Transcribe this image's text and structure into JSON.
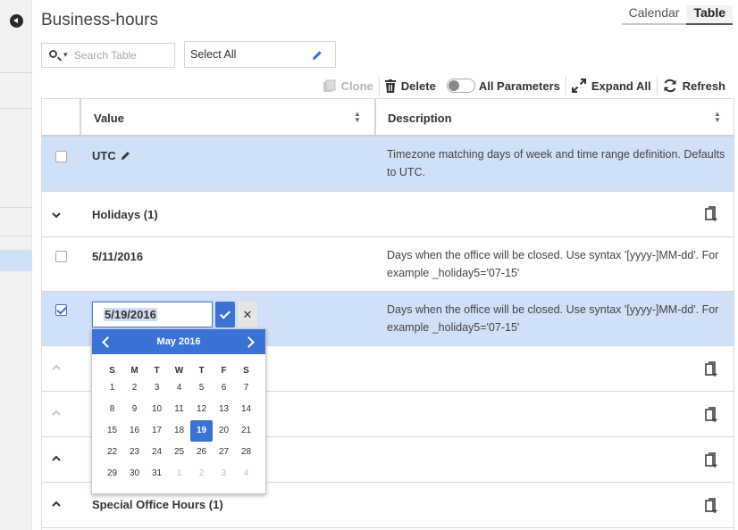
{
  "title": "Business-hours",
  "view_tabs": [
    "Calendar",
    "Table"
  ],
  "search": {
    "placeholder": "Search Table"
  },
  "select_all": {
    "label": "Select All"
  },
  "toolbar": {
    "clone": "Clone",
    "delete": "Delete",
    "all_parameters": "All Parameters",
    "expand_all": "Expand All",
    "refresh": "Refresh"
  },
  "columns": {
    "value": "Value",
    "description": "Description"
  },
  "rows": [
    {
      "type": "param",
      "value": "UTC",
      "description": "Timezone matching days of week and time range definition. Defaults to UTC.",
      "selected": true,
      "checked": false
    },
    {
      "type": "section",
      "label": "Holidays (1)",
      "expanded": true
    },
    {
      "type": "param",
      "value": "5/11/2016",
      "description": "Days when the office will be closed. Use syntax '[yyyy-]MM-dd'. For example _holiday5='07-15'",
      "selected": false,
      "checked": false
    },
    {
      "type": "edit",
      "value": "5/19/2016",
      "description": "Days when the office will be closed. Use syntax '[yyyy-]MM-dd'. For example _holiday5='07-15'",
      "selected": true,
      "checked": true
    },
    {
      "type": "section",
      "label": "",
      "expanded": false
    },
    {
      "type": "section",
      "label": "",
      "expanded": false
    },
    {
      "type": "section",
      "label": "",
      "expanded": false
    },
    {
      "type": "section",
      "label": "Special Office Hours (1)",
      "expanded": false
    }
  ],
  "calendar": {
    "month_label": "May 2016",
    "weekdays": [
      "S",
      "M",
      "T",
      "W",
      "T",
      "F",
      "S"
    ],
    "weeks": [
      [
        "1",
        "2",
        "3",
        "4",
        "5",
        "6",
        "7"
      ],
      [
        "8",
        "9",
        "10",
        "11",
        "12",
        "13",
        "14"
      ],
      [
        "15",
        "16",
        "17",
        "18",
        "19",
        "20",
        "21"
      ],
      [
        "22",
        "23",
        "24",
        "25",
        "26",
        "27",
        "28"
      ],
      [
        "29",
        "30",
        "31",
        "1",
        "2",
        "3",
        "4"
      ]
    ],
    "selected_day": "19"
  },
  "colors": {
    "accent": "#3b72d6",
    "selected_row": "#cfe0f8"
  }
}
